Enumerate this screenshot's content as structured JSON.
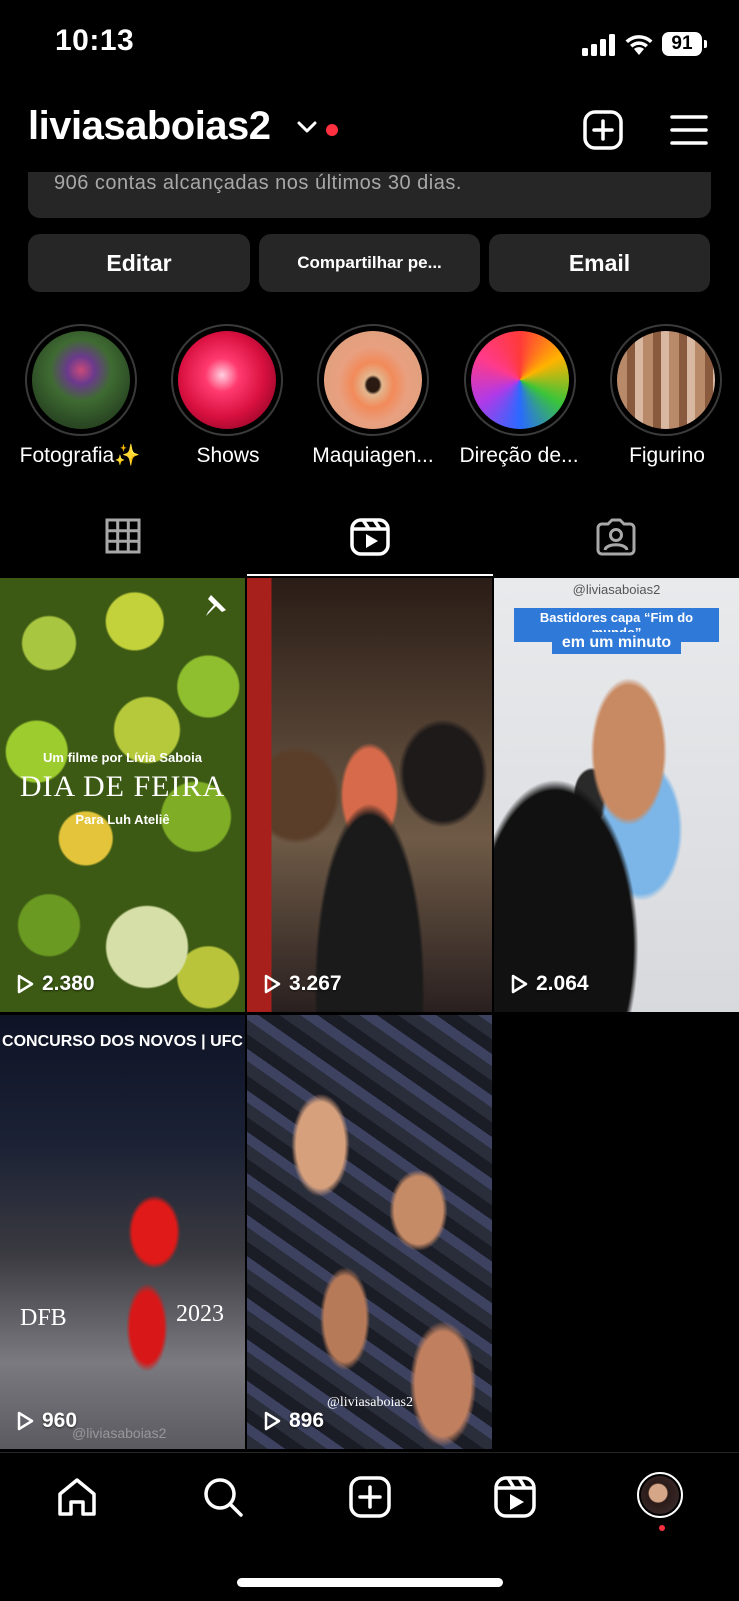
{
  "status_bar": {
    "time": "10:13",
    "battery": "91"
  },
  "header": {
    "username": "liviasaboias2"
  },
  "reach": {
    "text": "906 contas alcançadas nos últimos 30 dias."
  },
  "buttons": {
    "edit": "Editar",
    "share": "Compartilhar pe...",
    "email": "Email"
  },
  "highlights": [
    {
      "label": "Fotografia✨"
    },
    {
      "label": "Shows"
    },
    {
      "label": "Maquiagen..."
    },
    {
      "label": "Direção de..."
    },
    {
      "label": "Figurino"
    }
  ],
  "reels": [
    {
      "views": "2.380",
      "pinned": true,
      "overlay_top": "Um filme por Lívia Saboia",
      "overlay_title": "DIA DE FEIRA",
      "overlay_sub": "Para Luh Ateliê"
    },
    {
      "views": "3.267"
    },
    {
      "views": "2.064",
      "overlay_handle": "@liviasaboias2",
      "overlay_line1": "Bastidores capa “Fim do mundo”",
      "overlay_line2": "em um minuto"
    },
    {
      "views": "960",
      "overlay_top": "CONCURSO DOS NOVOS | UFC",
      "overlay_left": "DFB",
      "overlay_right": "2023",
      "overlay_watermark": "@liviasaboias2"
    },
    {
      "views": "896",
      "overlay_watermark": "@liviasaboias2"
    }
  ],
  "colors": {
    "background": "#000000",
    "card": "#262626",
    "notification": "#ff3040",
    "muted_text": "#a8a8a8"
  },
  "icons": [
    "signal-icon",
    "wifi-icon",
    "chevron-down-icon",
    "new-post-icon",
    "menu-icon",
    "grid-icon",
    "reels-icon",
    "tagged-icon",
    "pin-icon",
    "play-icon",
    "home-icon",
    "search-icon",
    "create-icon",
    "reels-nav-icon",
    "profile-avatar"
  ]
}
